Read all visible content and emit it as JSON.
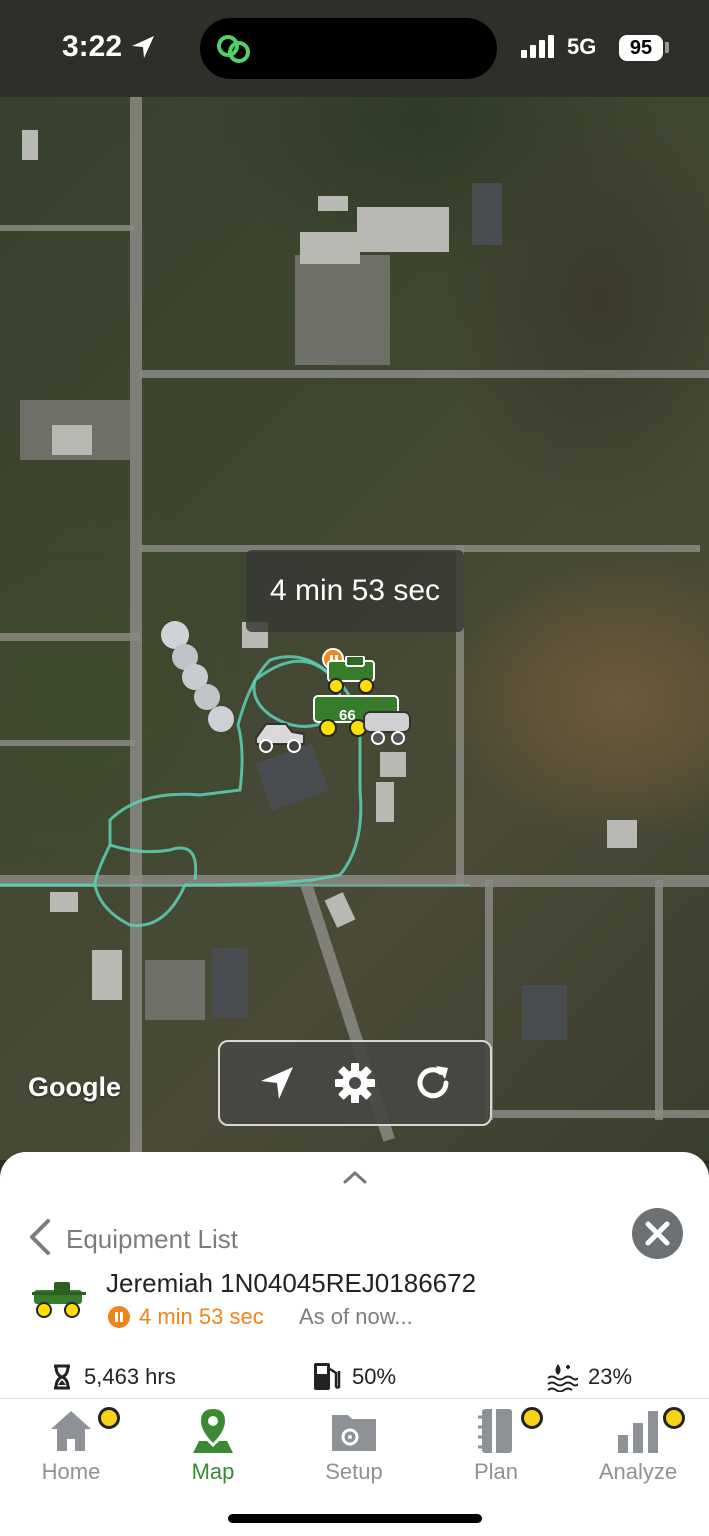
{
  "status_bar": {
    "time": "3:22",
    "network": "5G",
    "battery": "95",
    "location_icon": "location-arrow-icon",
    "island_icon": "link-icon"
  },
  "map": {
    "timer_label": "4 min 53 sec",
    "machine_number": "66",
    "attribution": "Google",
    "controls": {
      "locate_icon": "navigate-arrow-icon",
      "settings_icon": "gear-icon",
      "refresh_icon": "refresh-icon"
    },
    "colors": {
      "track": "#5ed0b5",
      "machine_green": "#367c2b",
      "machine_yellow": "#ffde00",
      "pause_orange": "#f08a1f"
    }
  },
  "sheet": {
    "title": "Equipment List",
    "equipment_name": "Jeremiah 1N04045REJ0186672",
    "status_time": "4 min 53 sec",
    "as_of": "As of now...",
    "metrics": {
      "hours": "5,463 hrs",
      "fuel": "50%",
      "def": "23%"
    }
  },
  "tabs": [
    {
      "label": "Home",
      "icon": "home-icon",
      "active": false,
      "notification": true
    },
    {
      "label": "Map",
      "icon": "map-pin-icon",
      "active": true,
      "notification": false
    },
    {
      "label": "Setup",
      "icon": "folder-gear-icon",
      "active": false,
      "notification": false
    },
    {
      "label": "Plan",
      "icon": "notebook-icon",
      "active": false,
      "notification": true
    },
    {
      "label": "Analyze",
      "icon": "bar-chart-icon",
      "active": false,
      "notification": true
    }
  ]
}
